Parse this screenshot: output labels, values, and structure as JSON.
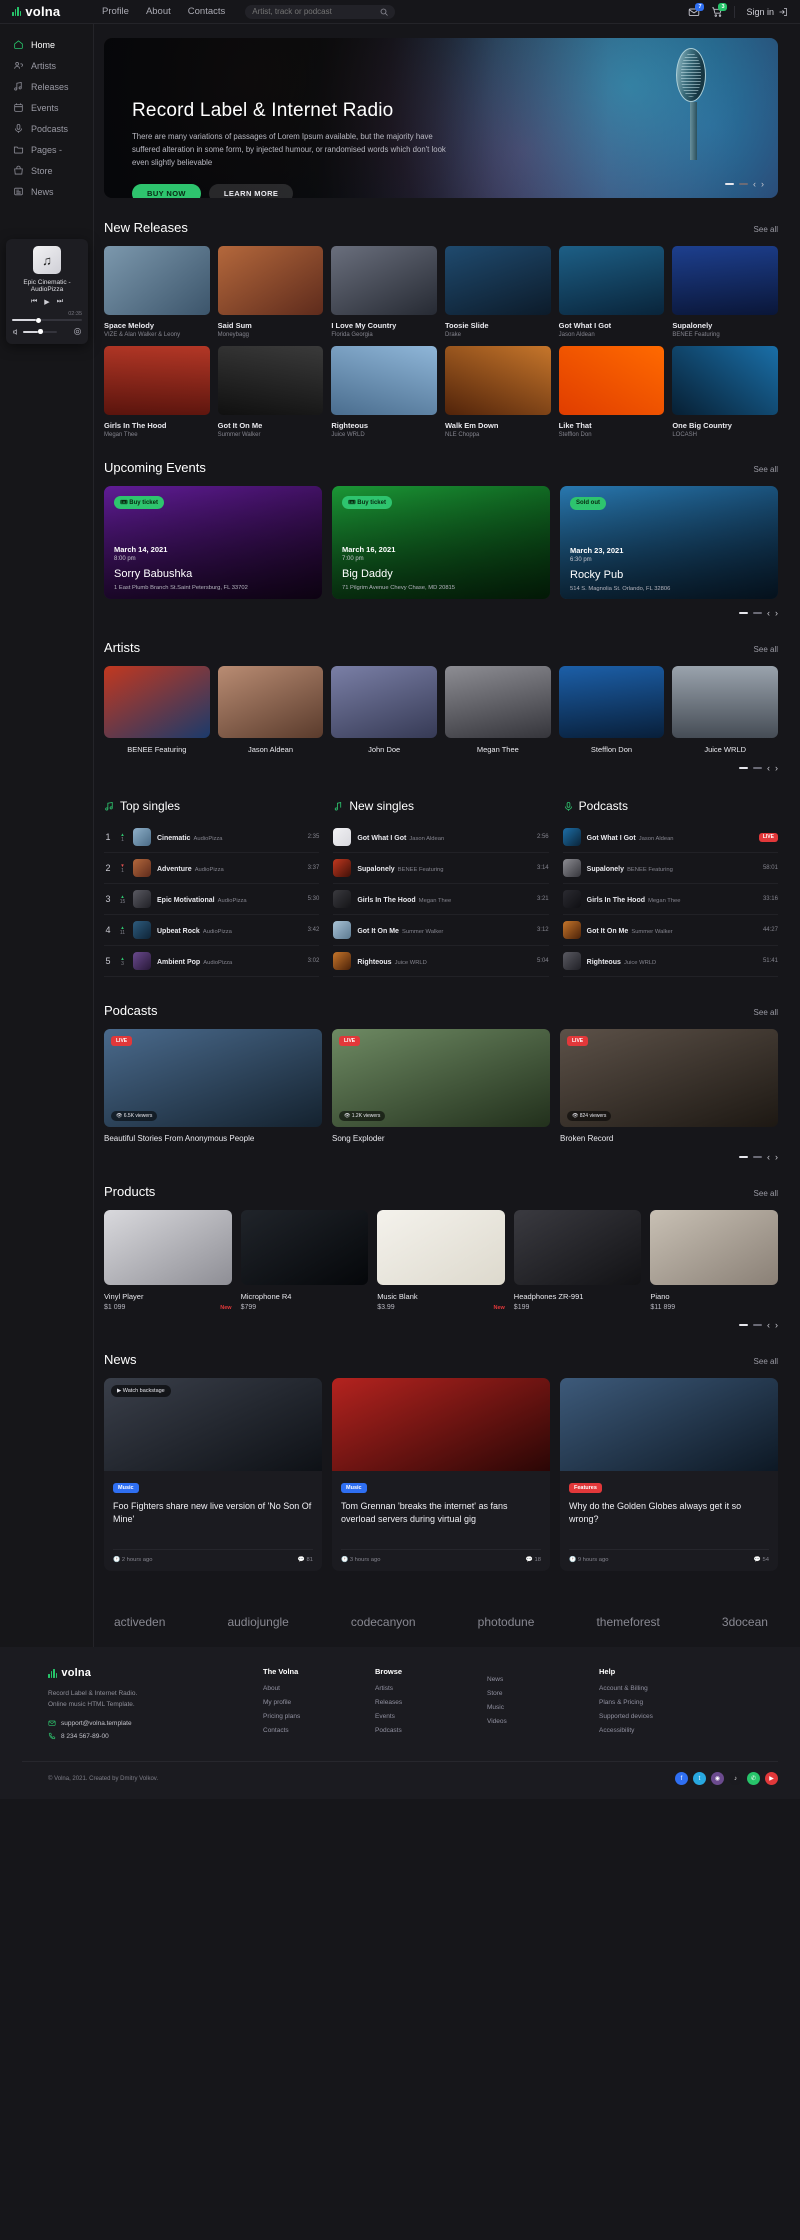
{
  "brand": {
    "name": "volna"
  },
  "topnav": {
    "items": [
      "Profile",
      "About",
      "Contacts"
    ]
  },
  "search": {
    "placeholder": "Artist, track or podcast",
    "value": ""
  },
  "account": {
    "messages_badge": "7",
    "cart_badge": "3",
    "signin_label": "Sign in"
  },
  "sidebar": {
    "items": [
      {
        "label": "Home",
        "icon": "home-icon",
        "active": true
      },
      {
        "label": "Artists",
        "icon": "users-icon",
        "active": false
      },
      {
        "label": "Releases",
        "icon": "music-note-icon",
        "active": false
      },
      {
        "label": "Events",
        "icon": "calendar-icon",
        "active": false
      },
      {
        "label": "Podcasts",
        "icon": "microphone-icon",
        "active": false
      },
      {
        "label": "Pages -",
        "icon": "folder-icon",
        "active": false
      },
      {
        "label": "Store",
        "icon": "store-icon",
        "active": false
      },
      {
        "label": "News",
        "icon": "newspaper-icon",
        "active": false
      }
    ]
  },
  "player": {
    "title": "Epic Cinematic - AudioPizza",
    "time": "02:35",
    "progress_pct": 34,
    "volume_pct": 45
  },
  "hero": {
    "title": "Record Label & Internet Radio",
    "text": "There are many variations of passages of Lorem Ipsum available, but the majority have suffered alteration in some form, by injected humour, or randomised words which don't look even slightly believable",
    "primary_btn": "BUY NOW",
    "secondary_btn": "LEARN MORE"
  },
  "new_releases": {
    "title": "New Releases",
    "see_all": "See all",
    "items": [
      {
        "name": "Space Melody",
        "artist": "VIZE & Alan Walker & Leony",
        "c1": "#7c98ad",
        "c2": "#3c556b"
      },
      {
        "name": "Said Sum",
        "artist": "Moneybagg",
        "c1": "#b4683c",
        "c2": "#5e2b1c"
      },
      {
        "name": "I Love My Country",
        "artist": "Florida Georgia",
        "c1": "#6a6f7d",
        "c2": "#262a33"
      },
      {
        "name": "Toosie Slide",
        "artist": "Drake",
        "c1": "#1f4a6e",
        "c2": "#0c1b2a"
      },
      {
        "name": "Got What I Got",
        "artist": "Jason Aldean",
        "c1": "#1d5f86",
        "c2": "#09243a"
      },
      {
        "name": "Supalonely",
        "artist": "BENEE Featuring",
        "c1": "#1d3f8e",
        "c2": "#0a1638"
      },
      {
        "name": "Girls In The Hood",
        "artist": "Megan Thee",
        "c1": "#b33726",
        "c2": "#5a140d"
      },
      {
        "name": "Got It On Me",
        "artist": "Summer Walker",
        "c1": "#3a3a3a",
        "c2": "#101010"
      },
      {
        "name": "Righteous",
        "artist": "Juice WRLD",
        "c1": "#8fb6d8",
        "c2": "#4a6d8e"
      },
      {
        "name": "Walk Em Down",
        "artist": "NLE Choppa",
        "c1": "#c6762b",
        "c2": "#51230a"
      },
      {
        "name": "Like That",
        "artist": "Stefflon Don",
        "c1": "#ff6a00",
        "c2": "#e03d00"
      },
      {
        "name": "One Big Country",
        "artist": "LOCASH",
        "c1": "#1a6fa8",
        "c2": "#071f33"
      }
    ]
  },
  "events": {
    "title": "Upcoming Events",
    "see_all": "See all",
    "items": [
      {
        "tag": "Buy ticket",
        "tag_type": "buy",
        "date": "March 14, 2021",
        "time": "8:00 pm",
        "name": "Sorry Babushka",
        "address": "1 East Plumb Branch St.Saint Petersburg, FL 33702",
        "c1": "#6b1fa8",
        "c2": "#22062f"
      },
      {
        "tag": "Buy ticket",
        "tag_type": "buy",
        "date": "March 16, 2021",
        "time": "7:00 pm",
        "name": "Big Daddy",
        "address": "71 Pilgrim Avenue Chevy Chase, MD 20815",
        "c1": "#1ea83c",
        "c2": "#073f10"
      },
      {
        "tag": "Sold out",
        "tag_type": "sold",
        "date": "March 23, 2021",
        "time": "6:30 pm",
        "name": "Rocky Pub",
        "address": "514 S. Magnolia St. Orlando, FL 32806",
        "c1": "#2d86c4",
        "c2": "#0c2c49"
      }
    ]
  },
  "artists": {
    "title": "Artists",
    "see_all": "See all",
    "items": [
      {
        "name": "BENEE Featuring",
        "c1": "#c2381f",
        "c2": "#1b3a6b"
      },
      {
        "name": "Jason Aldean",
        "c1": "#b98c73",
        "c2": "#5a3b2c"
      },
      {
        "name": "John Doe",
        "c1": "#7a7fa6",
        "c2": "#363a55"
      },
      {
        "name": "Megan Thee",
        "c1": "#8d8d93",
        "c2": "#35353b"
      },
      {
        "name": "Stefflon Don",
        "c1": "#1c5fa8",
        "c2": "#081f3a"
      },
      {
        "name": "Juice WRLD",
        "c1": "#9aa3ad",
        "c2": "#454c55"
      }
    ]
  },
  "top_singles": {
    "title": "Top singles",
    "icon": "music-notes-icon",
    "rows": [
      {
        "rank": "1",
        "delta": "up",
        "delta_value": "1",
        "name": "Cinematic",
        "artist": "AudioPizza",
        "time": "2:35",
        "c1": "#8fb0c9",
        "c2": "#4a6b86"
      },
      {
        "rank": "2",
        "delta": "down",
        "delta_value": "1",
        "name": "Adventure",
        "artist": "AudioPizza",
        "time": "3:37",
        "c1": "#b4683c",
        "c2": "#5e2b1c"
      },
      {
        "rank": "3",
        "delta": "up",
        "delta_value": "15",
        "name": "Epic Motivational",
        "artist": "AudioPizza",
        "time": "5:30",
        "c1": "#5a5a62",
        "c2": "#202026"
      },
      {
        "rank": "4",
        "delta": "up",
        "delta_value": "11",
        "name": "Upbeat Rock",
        "artist": "AudioPizza",
        "time": "3:42",
        "c1": "#2e5c7e",
        "c2": "#0e2336"
      },
      {
        "rank": "5",
        "delta": "up",
        "delta_value": "3",
        "name": "Ambient Pop",
        "artist": "AudioPizza",
        "time": "3:02",
        "c1": "#6a4a8e",
        "c2": "#281838"
      }
    ]
  },
  "new_singles": {
    "title": "New singles",
    "icon": "music-note-icon",
    "rows": [
      {
        "name": "Got What I Got",
        "artist": "Jason Aldean",
        "time": "2:56",
        "c1": "#f2f2f4",
        "c2": "#d8d8de"
      },
      {
        "name": "Supalonely",
        "artist": "BENEE Featuring",
        "time": "3:14",
        "c1": "#c2381f",
        "c2": "#3f1008"
      },
      {
        "name": "Girls In The Hood",
        "artist": "Megan Thee",
        "time": "3:21",
        "c1": "#3a3a3f",
        "c2": "#141417"
      },
      {
        "name": "Got It On Me",
        "artist": "Summer Walker",
        "time": "3:12",
        "c1": "#a9c3d6",
        "c2": "#5c7a91"
      },
      {
        "name": "Righteous",
        "artist": "Juice WRLD",
        "time": "5:04",
        "c1": "#c6762b",
        "c2": "#4a2108"
      }
    ]
  },
  "podcasts_list": {
    "title": "Podcasts",
    "icon": "microphone-icon",
    "rows": [
      {
        "name": "Got What I Got",
        "artist": "Jason Aldean",
        "time": "",
        "live": "LIVE",
        "c1": "#1d6fa8",
        "c2": "#0a2438"
      },
      {
        "name": "Supalonely",
        "artist": "BENEE Featuring",
        "time": "58:01",
        "live": "",
        "c1": "#8d8d93",
        "c2": "#35353b"
      },
      {
        "name": "Girls In The Hood",
        "artist": "Megan Thee",
        "time": "33:16",
        "live": "",
        "c1": "#2b2b31",
        "c2": "#0f0f13"
      },
      {
        "name": "Got It On Me",
        "artist": "Summer Walker",
        "time": "44:27",
        "live": "",
        "c1": "#c6762b",
        "c2": "#4a2108"
      },
      {
        "name": "Righteous",
        "artist": "Juice WRLD",
        "time": "51:41",
        "live": "",
        "c1": "#5a5a62",
        "c2": "#202026"
      }
    ]
  },
  "podcasts": {
    "title": "Podcasts",
    "see_all": "See all",
    "items": [
      {
        "name": "Beautiful Stories From Anonymous People",
        "live": "LIVE",
        "views": "6.5K viewers",
        "c1": "#4a6a8c",
        "c2": "#14222f"
      },
      {
        "name": "Song Exploder",
        "live": "LIVE",
        "views": "1.2K viewers",
        "c1": "#6e8a63",
        "c2": "#22301c"
      },
      {
        "name": "Broken Record",
        "live": "LIVE",
        "views": "824 viewers",
        "c1": "#5c5148",
        "c2": "#1d1813"
      }
    ]
  },
  "products": {
    "title": "Products",
    "see_all": "See all",
    "items": [
      {
        "name": "Vinyl Player",
        "price": "$1 099",
        "badge": "New",
        "c1": "#d9d9dd",
        "c2": "#8e8e95"
      },
      {
        "name": "Microphone R4",
        "price": "$799",
        "badge": "",
        "c1": "#20242a",
        "c2": "#05070a"
      },
      {
        "name": "Music Blank",
        "price": "$3.99",
        "badge": "New",
        "c1": "#f4f2ec",
        "c2": "#ddd9cd"
      },
      {
        "name": "Headphones ZR-991",
        "price": "$199",
        "badge": "",
        "c1": "#3a3a40",
        "c2": "#121215"
      },
      {
        "name": "Piano",
        "price": "$11 899",
        "badge": "",
        "c1": "#c8c0b4",
        "c2": "#8a8076"
      }
    ]
  },
  "news": {
    "title": "News",
    "see_all": "See all",
    "items": [
      {
        "tag": "Music",
        "tag_color": "#2f6ff2",
        "title": "Foo Fighters share new live version of 'No Son Of Mine'",
        "time": "2 hours ago",
        "comments": "81",
        "watch": "Watch backstage",
        "has_watch": true,
        "c1": "#3a3f4a",
        "c2": "#0e1116"
      },
      {
        "tag": "Music",
        "tag_color": "#2f6ff2",
        "title": "Tom Grennan 'breaks the internet' as fans overload servers during virtual gig",
        "time": "3 hours ago",
        "comments": "18",
        "watch": "",
        "has_watch": false,
        "c1": "#b4231f",
        "c2": "#2a0605"
      },
      {
        "tag": "Features",
        "tag_color": "#e2383a",
        "title": "Why do the Golden Globes always get it so wrong?",
        "time": "9 hours ago",
        "comments": "54",
        "watch": "",
        "has_watch": false,
        "c1": "#3d5a7a",
        "c2": "#0d1824"
      }
    ]
  },
  "partners": {
    "items": [
      "activeden",
      "audiojungle",
      "codecanyon",
      "photodune",
      "themeforest",
      "3docean"
    ]
  },
  "footer": {
    "brand": "volna",
    "description": "Record Label & Internet Radio.\nOnline music HTML Template.",
    "email": "support@volna.template",
    "phone": "8 234 567-89-00",
    "columns": [
      {
        "heading": "The Volna",
        "links": [
          "About",
          "My profile",
          "Pricing plans",
          "Contacts"
        ]
      },
      {
        "heading": "Browse",
        "links": [
          "Artists",
          "Releases",
          "Events",
          "Podcasts"
        ]
      },
      {
        "heading": "",
        "links": [
          "News",
          "Store",
          "Music",
          "Videos"
        ]
      },
      {
        "heading": "Help",
        "links": [
          "Account & Billing",
          "Plans & Pricing",
          "Supported devices",
          "Accessibility"
        ]
      }
    ],
    "copyright": "© Volna, 2021. Created by Dmitry Volkov.",
    "socials": [
      {
        "name": "facebook-icon",
        "glyph": "f",
        "color": "#2f6ff2"
      },
      {
        "name": "twitter-icon",
        "glyph": "t",
        "color": "#28a8e0"
      },
      {
        "name": "instagram-icon",
        "glyph": "◉",
        "color": "#6b4a8e"
      },
      {
        "name": "tiktok-icon",
        "glyph": "♪",
        "color": "#1a1a1f"
      },
      {
        "name": "whatsapp-icon",
        "glyph": "✆",
        "color": "#27c46a"
      },
      {
        "name": "youtube-icon",
        "glyph": "▶",
        "color": "#e2383a"
      }
    ]
  },
  "carousel": {
    "prev": "‹",
    "next": "›"
  }
}
